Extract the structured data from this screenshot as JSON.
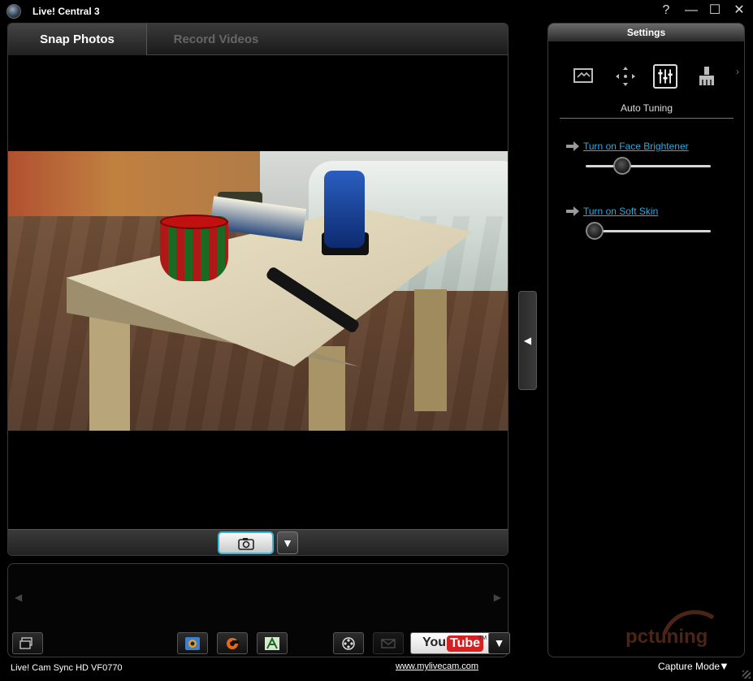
{
  "app": {
    "title": "Live! Central 3"
  },
  "window_controls": {
    "help": "?",
    "minimize": "—",
    "maximize": "☐",
    "close": "✕"
  },
  "tabs": [
    {
      "label": "Snap Photos",
      "active": true
    },
    {
      "label": "Record Videos",
      "active": false
    }
  ],
  "preview": {
    "collapse_arrow": "◀",
    "capture_menu_arrow": "▼",
    "capture_icon": "camera-icon"
  },
  "gallery": {
    "prev_arrow": "◀",
    "next_arrow": "▶",
    "toolbar": [
      {
        "icon": "folder-icon"
      },
      {
        "icon": "photo-frame-icon"
      },
      {
        "icon": "fireworks-icon"
      },
      {
        "icon": "font-effect-icon"
      },
      {
        "icon": "film-reel-icon"
      },
      {
        "icon": "mail-icon"
      }
    ],
    "youtube": {
      "you": "You",
      "tube": "Tube",
      "tm": "TM",
      "menu_arrow": "▼"
    }
  },
  "settings": {
    "title": "Settings",
    "icons": [
      "screen-icon",
      "move-icon",
      "tuning-sliders-icon",
      "brush-icon"
    ],
    "more_arrow": "›",
    "section": "Auto Tuning",
    "options": [
      {
        "label": "Turn on Face Brightener",
        "slider_value": 0.26
      },
      {
        "label": "Turn on Soft Skin",
        "slider_value": 0.0
      }
    ]
  },
  "statusbar": {
    "device": "Live! Cam Sync HD VF0770",
    "link": "www.mylivecam.com",
    "mode": "Capture Mode",
    "mode_arrow": "▼"
  },
  "watermark": {
    "text": "pctuning"
  },
  "colors": {
    "accent": "#2fa9e0",
    "capture_border": "#36b8d8",
    "youtube_red": "#d42222"
  }
}
